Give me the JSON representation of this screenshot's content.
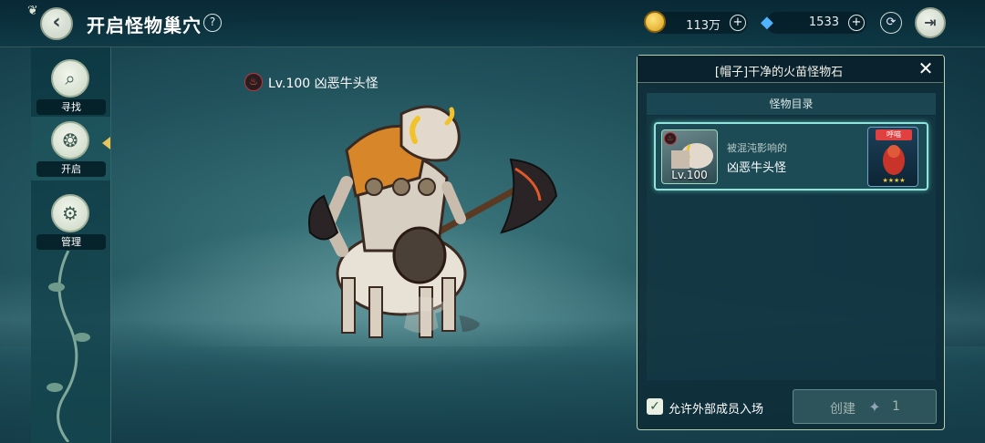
{
  "header": {
    "title": "开启怪物巢穴",
    "help_icon": "?",
    "back_icon": "back-arrow-icon",
    "exit_icon": "exit-icon",
    "refresh_icon": "refresh-icon"
  },
  "currencies": {
    "gold": {
      "icon": "gold-coin-icon",
      "value": "113万",
      "plus": "+"
    },
    "gem": {
      "icon": "blue-gem-icon",
      "value": "1533",
      "plus": "+"
    }
  },
  "sidebar": {
    "items": [
      {
        "label": "寻找",
        "icon": "search-icon",
        "active": false
      },
      {
        "label": "开启",
        "icon": "nest-open-icon",
        "active": true
      },
      {
        "label": "管理",
        "icon": "manage-gear-icon",
        "active": false
      }
    ]
  },
  "monster": {
    "title": "Lv.100 凶恶牛头怪",
    "element_icon": "fire-element-icon"
  },
  "panel": {
    "title": "[帽子]干净的火苗怪物石",
    "close": "✕",
    "section_title": "怪物目录",
    "card": {
      "level": "Lv.100",
      "subtitle": "被混沌影响的",
      "name": "凶恶牛头怪",
      "pet_tag": "呼喵",
      "stars": "★★★★"
    },
    "allow_checkbox_checked": true,
    "allow_label": "允许外部成员入场",
    "create_label": "创建",
    "create_count": "1"
  },
  "colors": {
    "panel_border": "#b9cfb2",
    "card_highlight": "#8fe4dc",
    "fire_red": "#c0343a"
  }
}
